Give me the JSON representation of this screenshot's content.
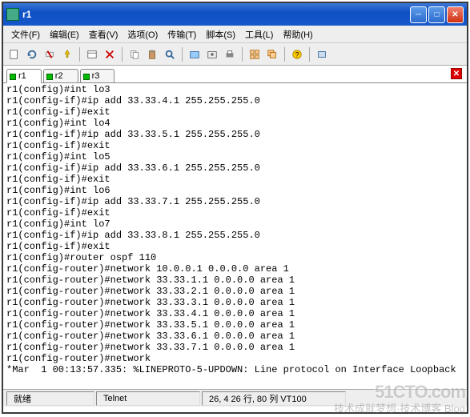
{
  "window": {
    "title": "r1"
  },
  "menu": {
    "file": "文件(F)",
    "edit": "编辑(E)",
    "view": "查看(V)",
    "options": "选项(O)",
    "transfer": "传输(T)",
    "script": "脚本(S)",
    "tools": "工具(L)",
    "help": "帮助(H)"
  },
  "tabs": {
    "t1": "r1",
    "t2": "r2",
    "t3": "r3"
  },
  "terminal": "r1(config)#int lo3\nr1(config-if)#ip add 33.33.4.1 255.255.255.0\nr1(config-if)#exit\nr1(config)#int lo4\nr1(config-if)#ip add 33.33.5.1 255.255.255.0\nr1(config-if)#exit\nr1(config)#int lo5\nr1(config-if)#ip add 33.33.6.1 255.255.255.0\nr1(config-if)#exit\nr1(config)#int lo6\nr1(config-if)#ip add 33.33.7.1 255.255.255.0\nr1(config-if)#exit\nr1(config)#int lo7\nr1(config-if)#ip add 33.33.8.1 255.255.255.0\nr1(config-if)#exit\nr1(config)#router ospf 110\nr1(config-router)#network 10.0.0.1 0.0.0.0 area 1\nr1(config-router)#network 33.33.1.1 0.0.0.0 area 1\nr1(config-router)#network 33.33.2.1 0.0.0.0 area 1\nr1(config-router)#network 33.33.3.1 0.0.0.0 area 1\nr1(config-router)#network 33.33.4.1 0.0.0.0 area 1\nr1(config-router)#network 33.33.5.1 0.0.0.0 area 1\nr1(config-router)#network 33.33.6.1 0.0.0.0 area 1\nr1(config-router)#network 33.33.7.1 0.0.0.0 area 1\nr1(config-router)#network\n*Mar  1 00:13:57.335: %LINEPROTO-5-UPDOWN: Line protocol on Interface Loopback",
  "status": {
    "ready": "就绪",
    "proto": "Telnet",
    "pos": "26,  4  26 行, 80 列  VT100"
  },
  "watermark": {
    "main": "51CTO.com",
    "sub": "技术成就梦想·技术博客 Blog"
  }
}
